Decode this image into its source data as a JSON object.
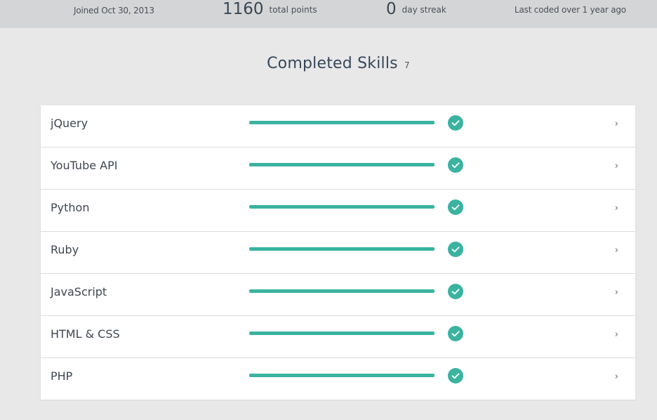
{
  "stats": {
    "joined": "Joined Oct 30, 2013",
    "points_value": "1160",
    "points_label": "total points",
    "streak_value": "0",
    "streak_label": "day streak",
    "last_coded": "Last coded over 1 year ago"
  },
  "section": {
    "title": "Completed Skills",
    "count": "7"
  },
  "skills": [
    {
      "name": "jQuery",
      "progress": 1.0,
      "status_icon": "check-circle-icon",
      "chevron": "›"
    },
    {
      "name": "YouTube API",
      "progress": 1.0,
      "status_icon": "check-circle-icon",
      "chevron": "›"
    },
    {
      "name": "Python",
      "progress": 1.0,
      "status_icon": "check-circle-icon",
      "chevron": "›"
    },
    {
      "name": "Ruby",
      "progress": 1.0,
      "status_icon": "check-circle-icon",
      "chevron": "›"
    },
    {
      "name": "JavaScript",
      "progress": 1.0,
      "status_icon": "check-circle-icon",
      "chevron": "›"
    },
    {
      "name": "HTML & CSS",
      "progress": 1.0,
      "status_icon": "check-circle-icon",
      "chevron": "›"
    },
    {
      "name": "PHP",
      "progress": 1.0,
      "status_icon": "check-circle-icon",
      "chevron": "›"
    }
  ],
  "colors": {
    "accent": "#3ab3a0",
    "stats_bar_bg": "#d4d5d6",
    "page_bg": "#e8e8e8",
    "card_bg": "#ffffff"
  }
}
